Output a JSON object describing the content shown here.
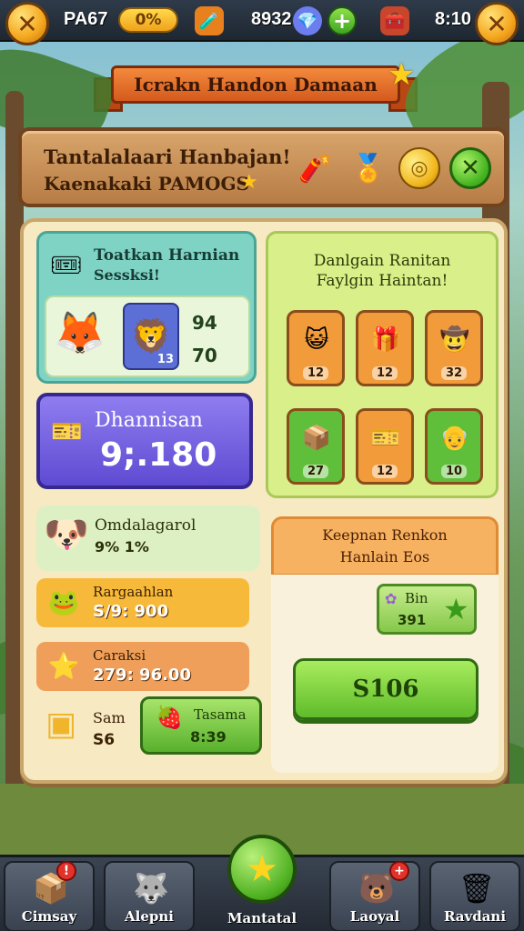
{
  "topbar": {
    "left_text": "PA67",
    "gold_pill": "0%",
    "gem_count": "8932",
    "time": "8:10",
    "close_symbol": "✕"
  },
  "ribbon": {
    "title": "Icrakn Handon Damaan"
  },
  "header_panel": {
    "line1": "Tantalalaari Hanbajan!",
    "line2": "Kaenakaki PAMOGS"
  },
  "teal_card": {
    "title1": "Toatkan Harnian",
    "title2": "Sessksi!",
    "stat1": "94",
    "stat2": "70",
    "portrait_level": "13"
  },
  "purple_card": {
    "label": "Dhannisan",
    "value": "9;.180"
  },
  "grid_card": {
    "heading1": "Danlgain Ranitan",
    "heading2": "Faylgin Haintan!",
    "tiles": [
      {
        "level": "12",
        "emoji": "😺",
        "bg": "#f29b3b"
      },
      {
        "level": "12",
        "emoji": "🎁",
        "bg": "#f29b3b"
      },
      {
        "level": "32",
        "emoji": "🤠",
        "bg": "#f29b3b"
      },
      {
        "level": "27",
        "emoji": "📦",
        "bg": "#5fbf3a"
      },
      {
        "level": "12",
        "emoji": "🎫",
        "bg": "#f29b3b"
      },
      {
        "level": "10",
        "emoji": "👴",
        "bg": "#5fbf3a"
      }
    ]
  },
  "side_card": {
    "title": "Omdalagarol",
    "subtitle": "9% 1%"
  },
  "rows": [
    {
      "label": "Rargaahlan",
      "value": "S/9: 900",
      "icon": "🐸",
      "bg": "#f7b93a"
    },
    {
      "label": "Caraksi",
      "value": "279: 96.00",
      "icon": "⭐",
      "bg": "#ef9f5a"
    }
  ],
  "small_row": {
    "label": "Sam",
    "value": "S6",
    "btn_label": "Tasama",
    "btn_value": "8:39"
  },
  "orange_card": {
    "line1": "Keepnan Renkon",
    "line2": "Hanlain Eos",
    "reward_label": "Bin",
    "reward_value": "391",
    "big_button": "S106"
  },
  "bottom_nav": [
    {
      "label": "Cimsay",
      "icon": "📦"
    },
    {
      "label": "Alepni",
      "icon": "🐺"
    },
    {
      "label": "Mantatal",
      "icon": "★"
    },
    {
      "label": "Laoyal",
      "icon": "🐻"
    },
    {
      "label": "Ravdani",
      "icon": "🗑"
    }
  ],
  "colors": {
    "accent_gold": "#f4a51c",
    "panel_wood": "#b77c45",
    "board_cream": "#f7e9c2",
    "button_green": "#58b02c",
    "card_purple": "#5e4bd2"
  }
}
